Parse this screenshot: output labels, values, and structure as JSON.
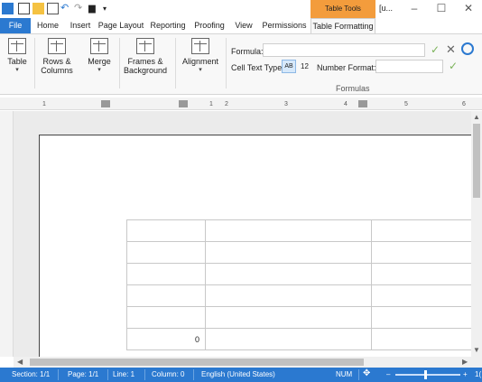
{
  "titlebar": {
    "context_tab_header": "Table Tools",
    "title": "[u...",
    "minimize": "–",
    "maximize": "☐",
    "close": "✕"
  },
  "ribbon_tabs": [
    "File",
    "Home",
    "Insert",
    "Page Layout",
    "Reporting",
    "Proofing",
    "View",
    "Permissions",
    "Table Formatting"
  ],
  "ribbon": {
    "table_label": "Table",
    "rows_columns_label_1": "Rows &",
    "rows_columns_label_2": "Columns",
    "merge_label": "Merge",
    "frames_background_label_1": "Frames &",
    "frames_background_label_2": "Background",
    "alignment_label": "Alignment",
    "formula_label": "Formula:",
    "formula_value": "",
    "cell_text_type_label": "Cell Text Type:",
    "cell_text_type_ab": "AB",
    "cell_text_type_12": "12",
    "number_format_label": "Number Format:",
    "number_format_value": "",
    "formulas_group_label": "Formulas",
    "dropdown_arrow": "▾"
  },
  "ruler_ticks": [
    "1",
    "1",
    "2",
    "3",
    "4",
    "5",
    "6"
  ],
  "document": {
    "table_rows": [
      [
        "",
        "",
        ""
      ],
      [
        "",
        "",
        ""
      ],
      [
        "",
        "",
        ""
      ],
      [
        "",
        "",
        ""
      ],
      [
        "",
        "",
        ""
      ],
      [
        "0",
        "",
        ""
      ]
    ]
  },
  "statusbar": {
    "section": "Section: 1/1",
    "page": "Page: 1/1",
    "line": "Line: 1",
    "column": "Column: 0",
    "language": "English (United States)",
    "num": "NUM",
    "zoom_minus": "–",
    "zoom_plus": "+",
    "zoom_level": "1("
  },
  "colors": {
    "accent": "#2b79d0",
    "context_tab": "#f39c3c"
  }
}
